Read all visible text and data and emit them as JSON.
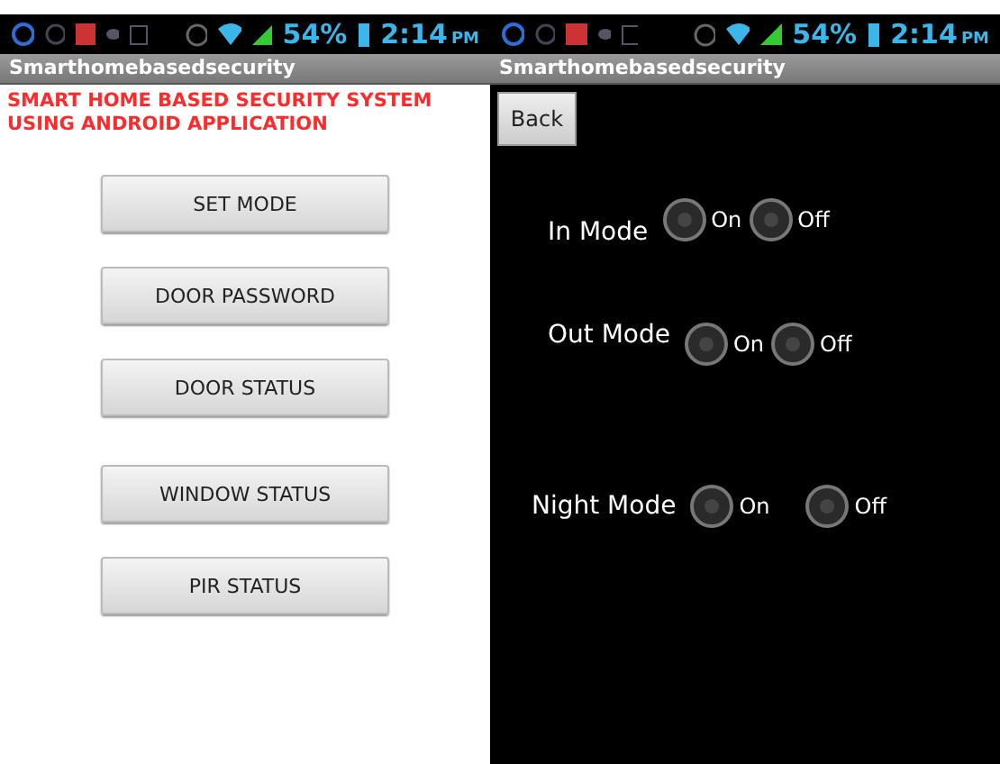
{
  "screens": [
    {
      "status_bar": {
        "battery": "54%",
        "time": "2:14",
        "ampm": "PM"
      },
      "title": "Smarthomebasedsecurity",
      "heading": "SMART HOME BASED SECURITY SYSTEM USING ANDROID APPLICATION",
      "buttons": [
        "SET MODE",
        "DOOR PASSWORD",
        "DOOR STATUS",
        "WINDOW STATUS",
        "PIR STATUS"
      ]
    },
    {
      "status_bar": {
        "battery": "54%",
        "time": "2:14",
        "ampm": "PM"
      },
      "title": "Smarthomebasedsecurity",
      "back_button": "Back",
      "modes": [
        {
          "label": "In Mode",
          "options": [
            {
              "label": "On",
              "selected": false
            },
            {
              "label": "Off",
              "selected": false
            }
          ]
        },
        {
          "label": "Out Mode",
          "options": [
            {
              "label": "On",
              "selected": false
            },
            {
              "label": "Off",
              "selected": false
            }
          ]
        },
        {
          "label": "Night Mode",
          "options": [
            {
              "label": "On",
              "selected": false
            },
            {
              "label": "Off",
              "selected": false
            }
          ]
        }
      ]
    }
  ]
}
